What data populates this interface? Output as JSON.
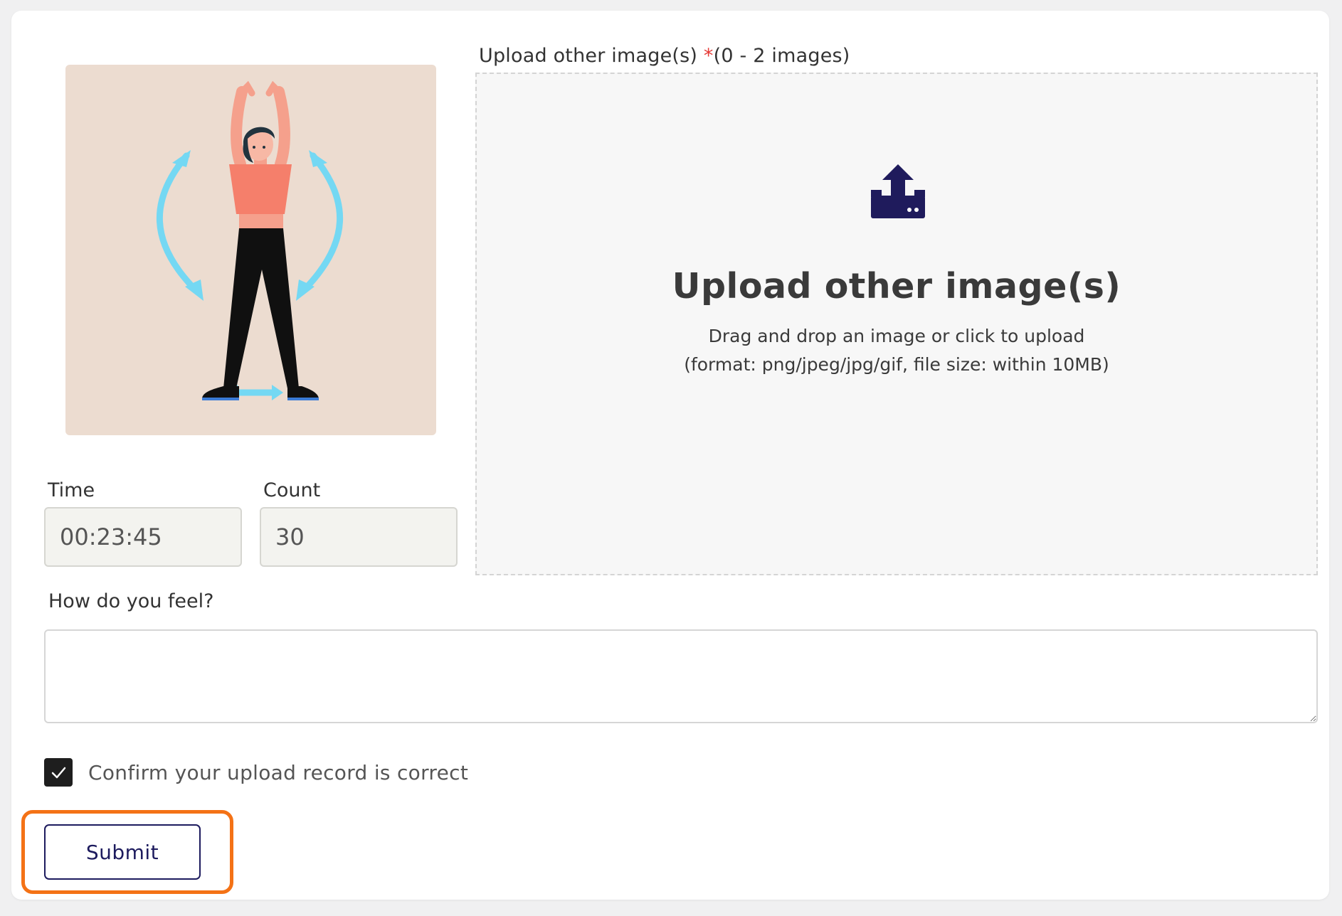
{
  "upload": {
    "label": "Upload other image(s) ",
    "required_mark": "*",
    "limit_text": "(0 - 2 images)",
    "dropzone_title": "Upload other image(s)",
    "dropzone_hint": "Drag and drop an image or click to upload",
    "dropzone_format": "(format: png/jpeg/jpg/gif, file size: within 10MB)",
    "icon": "upload-tray-icon",
    "icon_color": "#1f1b5c"
  },
  "illustration": {
    "icon": "jumping-jack-exercise-illustration"
  },
  "fields": {
    "time_label": "Time",
    "time_value": "00:23:45",
    "count_label": "Count",
    "count_value": "30",
    "feel_label": "How do you feel?",
    "feel_value": ""
  },
  "confirm": {
    "checked": true,
    "label": "Confirm your upload record is correct"
  },
  "submit": {
    "label": "Submit"
  },
  "colors": {
    "accent": "#1d1b5e",
    "highlight": "#f47216",
    "required": "#e53935"
  }
}
